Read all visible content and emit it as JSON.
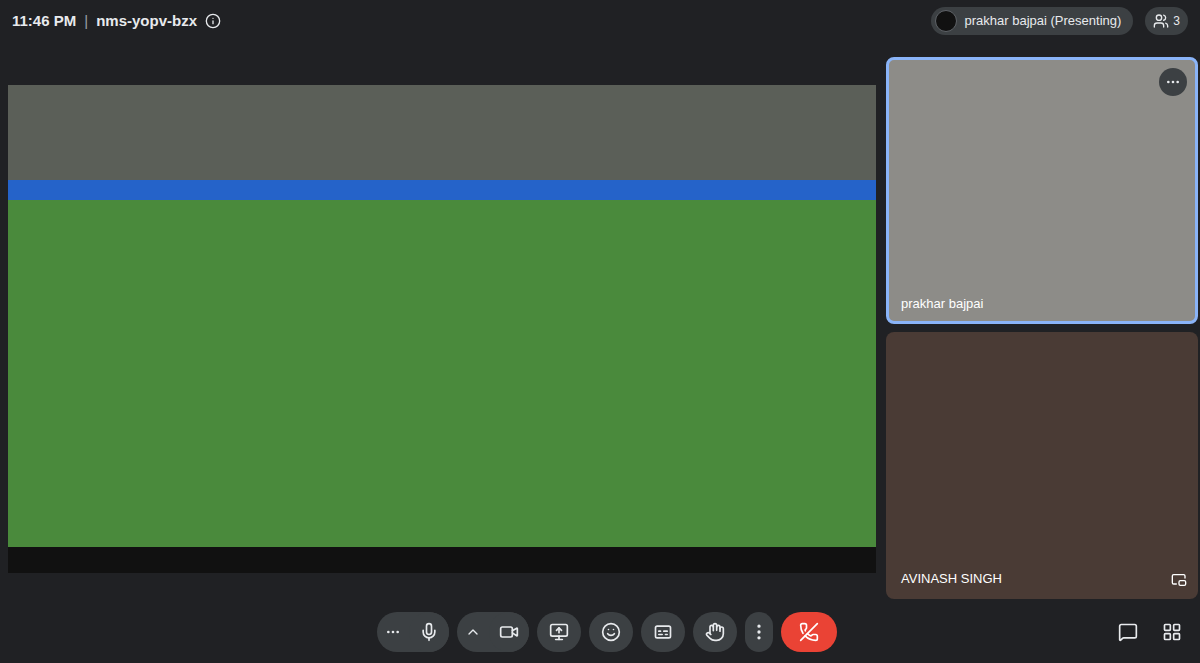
{
  "header": {
    "time": "11:46 PM",
    "separator": "|",
    "meeting_code": "nms-yopv-bzx"
  },
  "presenter_chip": {
    "label": "prakhar bajpai (Presenting)"
  },
  "participant_count": "3",
  "participants": [
    {
      "name": "prakhar bajpai",
      "highlighted": true
    },
    {
      "name": "AVINASH SINGH",
      "highlighted": false
    }
  ],
  "toolbar": {
    "device_controls": [
      {
        "kind": "mic",
        "on": true
      },
      {
        "kind": "camera",
        "on": true
      }
    ],
    "buttons": [
      {
        "kind": "present"
      },
      {
        "kind": "emoji"
      },
      {
        "kind": "captions"
      },
      {
        "kind": "hand"
      },
      {
        "kind": "more"
      },
      {
        "kind": "end-call"
      }
    ],
    "side": [
      {
        "kind": "chat"
      },
      {
        "kind": "apps"
      }
    ]
  }
}
